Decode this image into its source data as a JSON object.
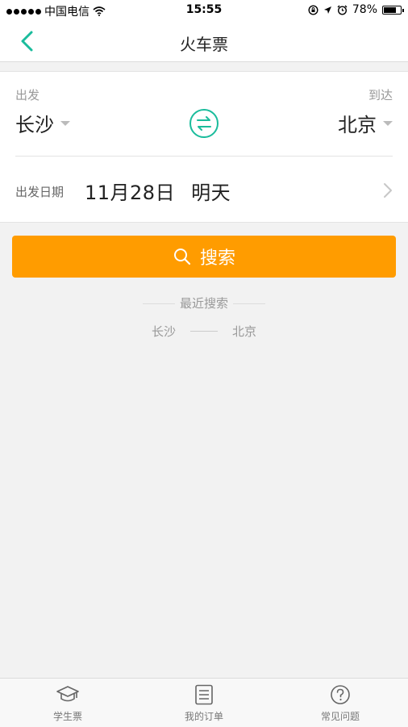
{
  "status_bar": {
    "carrier": "中国电信",
    "time": "15:55",
    "battery": "78%",
    "battery_level": 0.78
  },
  "nav": {
    "title": "火车票"
  },
  "trip": {
    "from_label": "出发",
    "from_city": "长沙",
    "to_label": "到达",
    "to_city": "北京",
    "date_label": "出发日期",
    "date": "11月28日",
    "day": "明天"
  },
  "search": {
    "label": "搜索"
  },
  "recent": {
    "title": "最近搜索",
    "from": "长沙",
    "to": "北京"
  },
  "tabs": [
    {
      "label": "学生票",
      "icon": "graduation-cap-icon"
    },
    {
      "label": "我的订单",
      "icon": "order-list-icon"
    },
    {
      "label": "常见问题",
      "icon": "question-icon"
    }
  ],
  "colors": {
    "accent": "#1abc9c",
    "button": "#ff9c00"
  }
}
